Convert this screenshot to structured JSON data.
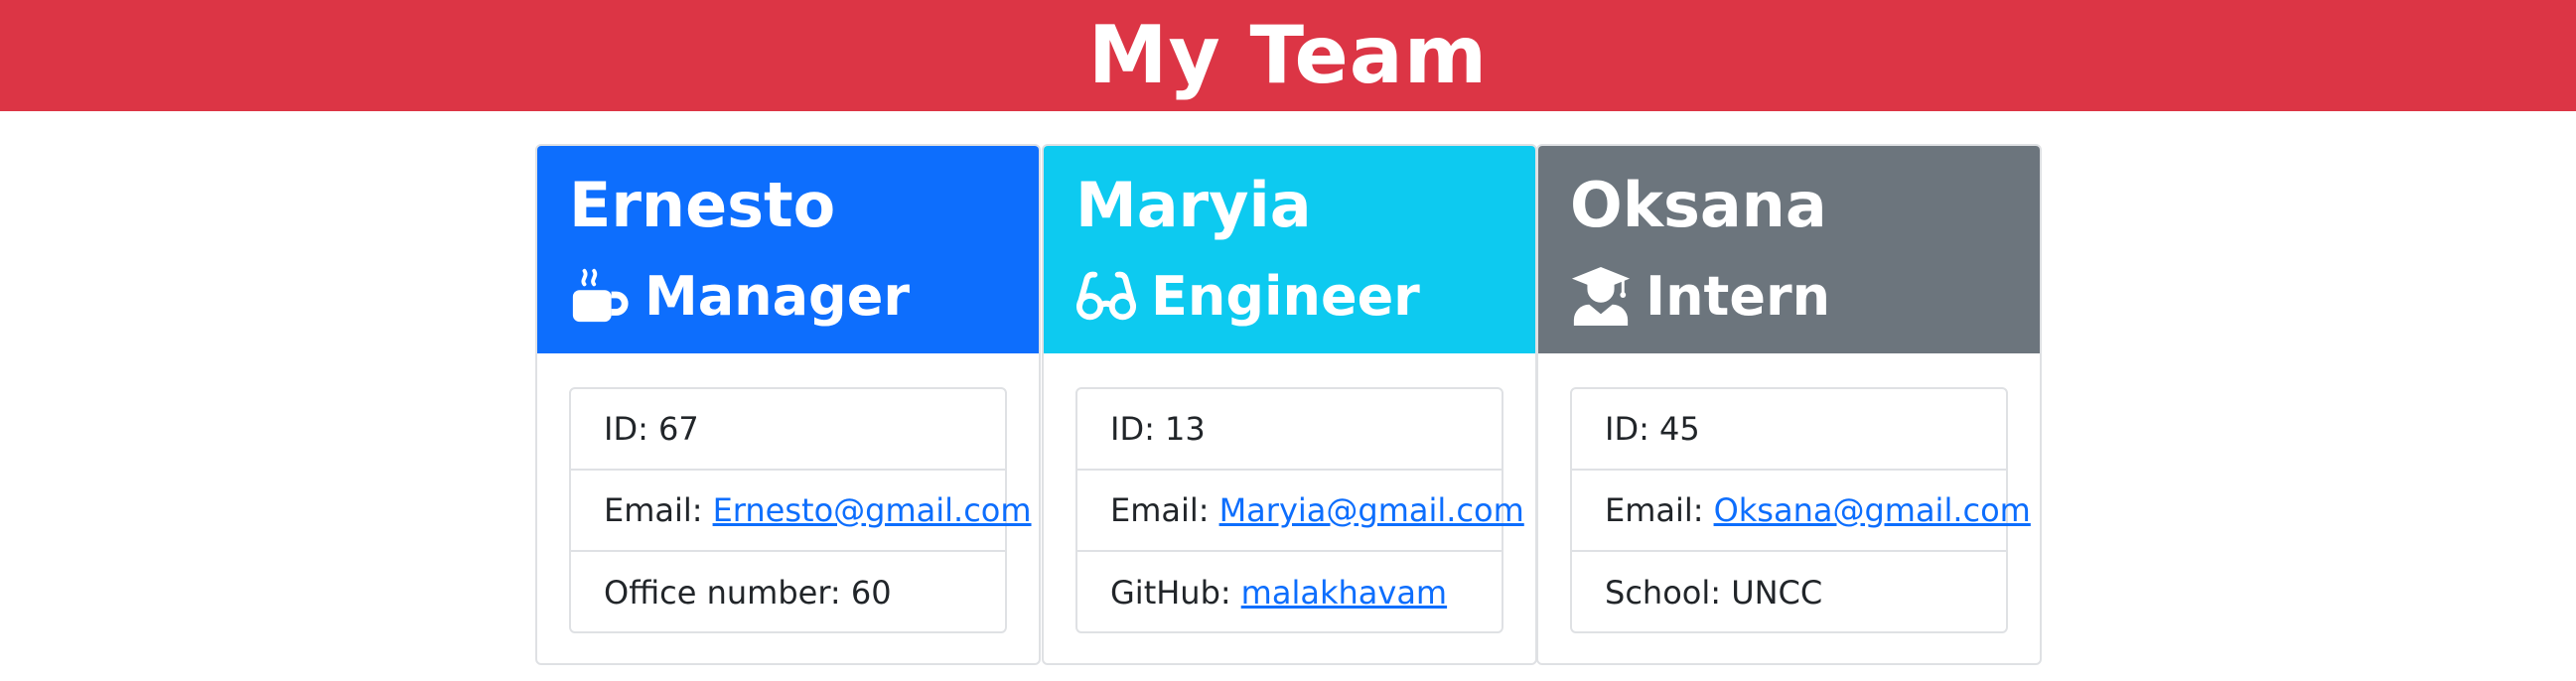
{
  "header": {
    "title": "My Team"
  },
  "colors": {
    "banner": "#dc3545",
    "manager": "#0d6efd",
    "engineer": "#0dcaf0",
    "intern": "#6c757d",
    "link": "#0d6efd"
  },
  "cards": [
    {
      "name": "Ernesto",
      "role": "Manager",
      "icon": "coffee-mug-icon",
      "rows": [
        {
          "label": "ID: 67"
        },
        {
          "label": "Email:",
          "link": "Ernesto@gmail.com"
        },
        {
          "label": "Office number: 60"
        }
      ]
    },
    {
      "name": "Maryia",
      "role": "Engineer",
      "icon": "glasses-icon",
      "rows": [
        {
          "label": "ID: 13"
        },
        {
          "label": "Email:",
          "link": "Maryia@gmail.com"
        },
        {
          "label": "GitHub:",
          "link": "malakhavam"
        }
      ]
    },
    {
      "name": "Oksana",
      "role": "Intern",
      "icon": "graduate-icon",
      "rows": [
        {
          "label": "ID: 45"
        },
        {
          "label": "Email:",
          "link": "Oksana@gmail.com"
        },
        {
          "label": "School: UNCC"
        }
      ]
    }
  ]
}
